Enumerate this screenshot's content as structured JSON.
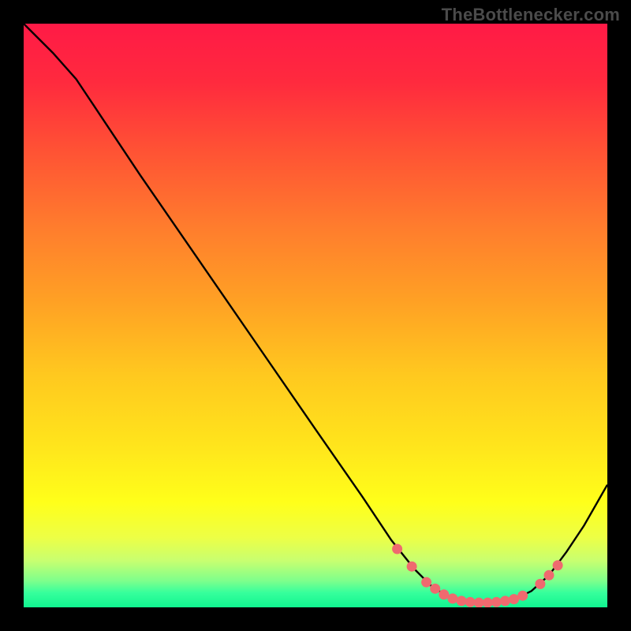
{
  "watermark": {
    "text": "TheBottlenecker.com"
  },
  "colors": {
    "page_bg": "#000000",
    "curve": "#000000",
    "dot_fill": "#ef6a6f",
    "dot_stroke": "#ef6a6f",
    "watermark_text": "#4b4b4b"
  },
  "gradient_stops": [
    {
      "offset": 0.0,
      "color": "#ff1a46"
    },
    {
      "offset": 0.1,
      "color": "#ff2a3e"
    },
    {
      "offset": 0.22,
      "color": "#ff5334"
    },
    {
      "offset": 0.35,
      "color": "#ff7d2d"
    },
    {
      "offset": 0.48,
      "color": "#ffa224"
    },
    {
      "offset": 0.6,
      "color": "#ffc81f"
    },
    {
      "offset": 0.72,
      "color": "#ffe41c"
    },
    {
      "offset": 0.82,
      "color": "#ffff1a"
    },
    {
      "offset": 0.88,
      "color": "#edff45"
    },
    {
      "offset": 0.92,
      "color": "#c8ff70"
    },
    {
      "offset": 0.955,
      "color": "#7dff8c"
    },
    {
      "offset": 0.975,
      "color": "#36ff9c"
    },
    {
      "offset": 1.0,
      "color": "#10f590"
    }
  ],
  "chart_data": {
    "type": "line",
    "title": "",
    "xlabel": "",
    "ylabel": "",
    "xlim": [
      0,
      100
    ],
    "ylim": [
      0,
      100
    ],
    "grid": false,
    "curve": [
      {
        "x": 0,
        "y": 100.0
      },
      {
        "x": 5,
        "y": 95.0
      },
      {
        "x": 9,
        "y": 90.5
      },
      {
        "x": 12,
        "y": 86.0
      },
      {
        "x": 20,
        "y": 74.0
      },
      {
        "x": 30,
        "y": 59.5
      },
      {
        "x": 40,
        "y": 45.0
      },
      {
        "x": 50,
        "y": 30.5
      },
      {
        "x": 58,
        "y": 19.0
      },
      {
        "x": 63,
        "y": 11.5
      },
      {
        "x": 67,
        "y": 6.5
      },
      {
        "x": 70,
        "y": 3.5
      },
      {
        "x": 73,
        "y": 1.7
      },
      {
        "x": 76,
        "y": 0.9
      },
      {
        "x": 80,
        "y": 0.8
      },
      {
        "x": 84,
        "y": 1.3
      },
      {
        "x": 87,
        "y": 2.8
      },
      {
        "x": 90,
        "y": 5.5
      },
      {
        "x": 93,
        "y": 9.5
      },
      {
        "x": 96,
        "y": 14.0
      },
      {
        "x": 100,
        "y": 21.0
      }
    ],
    "markers": [
      {
        "x": 64.0,
        "y": 10.0
      },
      {
        "x": 66.5,
        "y": 7.0
      },
      {
        "x": 69.0,
        "y": 4.3
      },
      {
        "x": 70.5,
        "y": 3.2
      },
      {
        "x": 72.0,
        "y": 2.2
      },
      {
        "x": 73.5,
        "y": 1.5
      },
      {
        "x": 75.0,
        "y": 1.1
      },
      {
        "x": 76.5,
        "y": 0.9
      },
      {
        "x": 78.0,
        "y": 0.8
      },
      {
        "x": 79.5,
        "y": 0.8
      },
      {
        "x": 81.0,
        "y": 0.9
      },
      {
        "x": 82.5,
        "y": 1.1
      },
      {
        "x": 84.0,
        "y": 1.4
      },
      {
        "x": 85.5,
        "y": 2.0
      },
      {
        "x": 88.5,
        "y": 4.0
      },
      {
        "x": 90.0,
        "y": 5.5
      },
      {
        "x": 91.5,
        "y": 7.2
      }
    ]
  }
}
